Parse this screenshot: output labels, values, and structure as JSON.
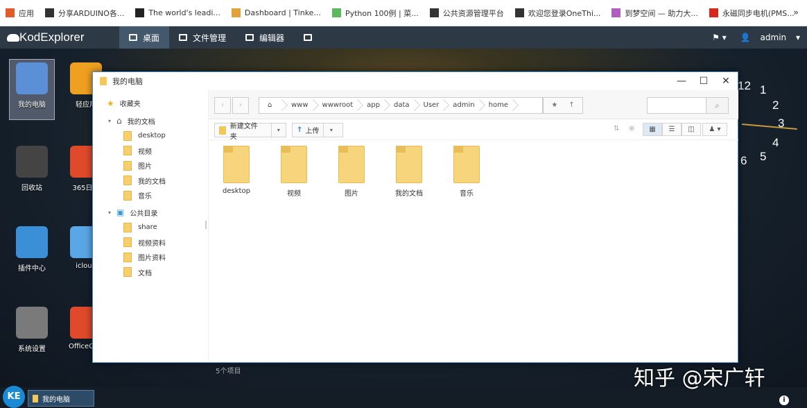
{
  "bookmarks": [
    {
      "label": "应用",
      "icon": "apps-grid-icon",
      "color": "#e35a2b"
    },
    {
      "label": "分享ARDUINO各...",
      "icon": "page-icon",
      "color": "#333333"
    },
    {
      "label": "The world's leadi...",
      "icon": "github-icon",
      "color": "#222222"
    },
    {
      "label": "Dashboard | Tinke...",
      "icon": "tinkercad-icon",
      "color": "#e2a13a"
    },
    {
      "label": "Python 100例 | 菜...",
      "icon": "runoob-icon",
      "color": "#5cb85c"
    },
    {
      "label": "公共资源管理平台",
      "icon": "page-icon",
      "color": "#333333"
    },
    {
      "label": "欢迎您登录OneThi...",
      "icon": "page-icon",
      "color": "#333333"
    },
    {
      "label": "到梦空间 — 助力大...",
      "icon": "dream-icon",
      "color": "#b05fc0"
    },
    {
      "label": "永磁同步电机(PMS...",
      "icon": "csdn-icon",
      "color": "#d8271c"
    }
  ],
  "bookmarks_more": "»",
  "app": {
    "title": "KodExplorer",
    "tabs": [
      {
        "label": "桌面",
        "active": true
      },
      {
        "label": "文件管理",
        "active": false
      },
      {
        "label": "编辑器",
        "active": false
      },
      {
        "label": "",
        "active": false
      }
    ],
    "user": "admin"
  },
  "desktop": {
    "icons": [
      {
        "label": "我的电脑",
        "color": "#5b8fd6",
        "selected": true
      },
      {
        "label": "轻应用",
        "color": "#f0a020"
      },
      {
        "label": "回收站",
        "color": "#444444"
      },
      {
        "label": "365日历",
        "color": "#e04a2a"
      },
      {
        "label": "插件中心",
        "color": "#3a8fd6"
      },
      {
        "label": "icloud",
        "color": "#5aa7e8"
      },
      {
        "label": "系统设置",
        "color": "#7a7a7a"
      },
      {
        "label": "OfficeConver",
        "color": "#e04a2a"
      }
    ]
  },
  "clock": {
    "numbers": [
      "12",
      "1",
      "2",
      "3",
      "4",
      "5",
      "6"
    ]
  },
  "window": {
    "title": "我的电脑",
    "sidebar": [
      {
        "label": "收藏夹",
        "type": "fav"
      },
      {
        "label": "我的文档",
        "type": "home"
      },
      {
        "label": "desktop"
      },
      {
        "label": "视频"
      },
      {
        "label": "图片"
      },
      {
        "label": "我的文档"
      },
      {
        "label": "音乐"
      },
      {
        "label": "公共目录",
        "type": "public"
      },
      {
        "label": "share"
      },
      {
        "label": "视频资料"
      },
      {
        "label": "图片资料"
      },
      {
        "label": "文档"
      }
    ],
    "path": [
      "www",
      "wwwroot",
      "app",
      "data",
      "User",
      "admin",
      "home"
    ],
    "toolbar": {
      "new_folder": "新建文件夹",
      "upload": "上传"
    },
    "files": [
      "desktop",
      "视频",
      "图片",
      "我的文档",
      "音乐"
    ],
    "count": "5个项目"
  },
  "taskbar": {
    "logo": "KE",
    "task": "我的电脑"
  },
  "watermark": "知乎 @宋广轩"
}
